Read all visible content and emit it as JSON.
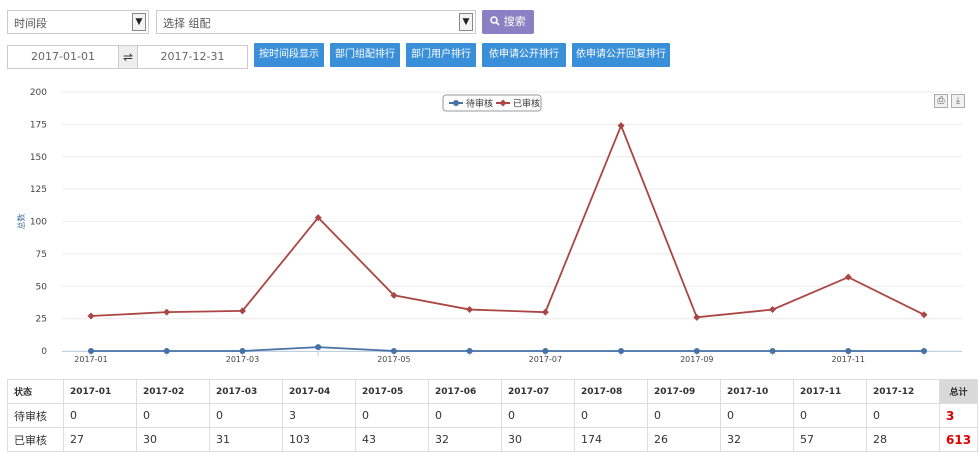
{
  "filters": {
    "period_select": "时间段",
    "group_select": "选择 组配",
    "search_label": "搜索",
    "date_from": "2017-01-01",
    "date_to": "2017-12-31",
    "range_separator": "⇌"
  },
  "action_buttons": [
    "按时间段显示",
    "部门组配排行",
    "部门用户排行",
    "依申请公开排行",
    "依申请公开回复排行"
  ],
  "chart_data": {
    "type": "line",
    "ylabel": "总数",
    "ylim": [
      0,
      200
    ],
    "yticks": [
      0,
      25,
      50,
      75,
      100,
      125,
      150,
      175,
      200
    ],
    "x": [
      "2017-01",
      "2017-02",
      "2017-03",
      "2017-04",
      "2017-05",
      "2017-06",
      "2017-07",
      "2017-08",
      "2017-09",
      "2017-10",
      "2017-11",
      "2017-12"
    ],
    "xtick_labels": [
      "2017-01",
      "2017-03",
      "2017-05",
      "2017-07",
      "2017-09",
      "2017-11"
    ],
    "legend_position": "top-center",
    "series": [
      {
        "name": "待审核",
        "color": "#4572a7",
        "marker": "circle",
        "values": [
          0,
          0,
          0,
          3,
          0,
          0,
          0,
          0,
          0,
          0,
          0,
          0
        ]
      },
      {
        "name": "已审核",
        "color": "#aa4643",
        "marker": "diamond",
        "values": [
          27,
          30,
          31,
          103,
          43,
          32,
          30,
          174,
          26,
          32,
          57,
          28
        ]
      }
    ]
  },
  "table": {
    "status_header": "状态",
    "total_header": "总计",
    "months": [
      "2017-01",
      "2017-02",
      "2017-03",
      "2017-04",
      "2017-05",
      "2017-06",
      "2017-07",
      "2017-08",
      "2017-09",
      "2017-10",
      "2017-11",
      "2017-12"
    ],
    "rows": [
      {
        "label": "待审核",
        "values": [
          "0",
          "0",
          "0",
          "3",
          "0",
          "0",
          "0",
          "0",
          "0",
          "0",
          "0",
          "0"
        ],
        "total": "3"
      },
      {
        "label": "已审核",
        "values": [
          "27",
          "30",
          "31",
          "103",
          "43",
          "32",
          "30",
          "174",
          "26",
          "32",
          "57",
          "28"
        ],
        "total": "613"
      }
    ]
  }
}
